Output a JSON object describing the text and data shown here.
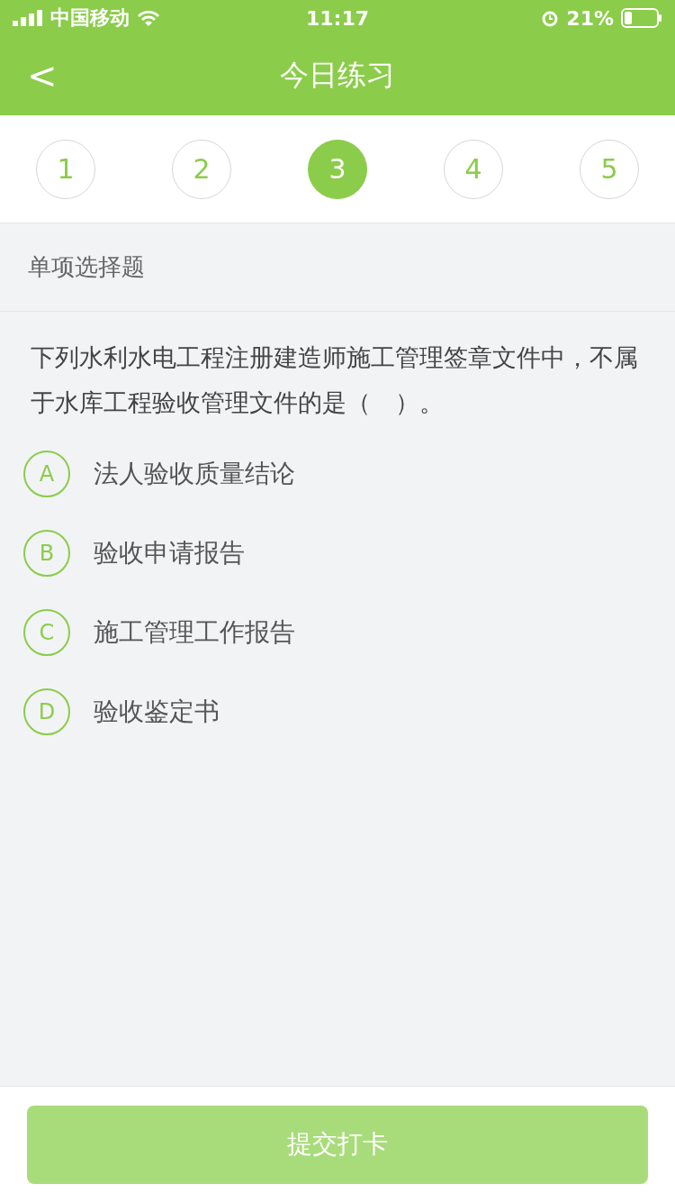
{
  "status_bar": {
    "carrier": "中国移动",
    "time": "11:17",
    "battery": "21%"
  },
  "nav": {
    "back": "<",
    "title": "今日练习"
  },
  "steps": [
    {
      "label": "1",
      "selected": false
    },
    {
      "label": "2",
      "selected": false
    },
    {
      "label": "3",
      "selected": true
    },
    {
      "label": "4",
      "selected": false
    },
    {
      "label": "5",
      "selected": false
    }
  ],
  "question_type": "单项选择题",
  "question": "下列水利水电工程注册建造师施工管理签章文件中，不属于水库工程验收管理文件的是（　）。",
  "options": [
    {
      "letter": "A",
      "text": "法人验收质量结论",
      "selected": false
    },
    {
      "letter": "B",
      "text": "验收申请报告",
      "selected": false
    },
    {
      "letter": "C",
      "text": "施工管理工作报告",
      "selected": false
    },
    {
      "letter": "D",
      "text": "验收鉴定书",
      "selected": false
    }
  ],
  "submit": {
    "label": "提交打卡",
    "disabled": true
  }
}
